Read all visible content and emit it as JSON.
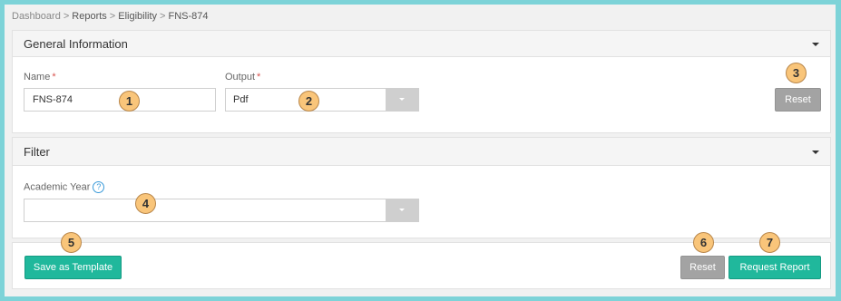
{
  "breadcrumb": [
    "Dashboard",
    "Reports",
    "Eligibility",
    "FNS-874"
  ],
  "breadcrumb_separator": ">",
  "general": {
    "title": "General Information",
    "name_label": "Name",
    "name_value": "FNS-874",
    "output_label": "Output",
    "output_value": "Pdf",
    "reset_label": "Reset",
    "required_marker": "*"
  },
  "filter": {
    "title": "Filter",
    "academic_year_label": "Academic Year",
    "academic_year_value": "",
    "help_glyph": "?"
  },
  "footer": {
    "save_template_label": "Save as Template",
    "reset_label": "Reset",
    "request_label": "Request Report"
  },
  "callouts": [
    "1",
    "2",
    "3",
    "4",
    "5",
    "6",
    "7"
  ],
  "colors": {
    "accent": "#20b89c",
    "gray_button": "#a3a3a3",
    "callout": "#f9c57a",
    "border": "#7dd3d8"
  }
}
